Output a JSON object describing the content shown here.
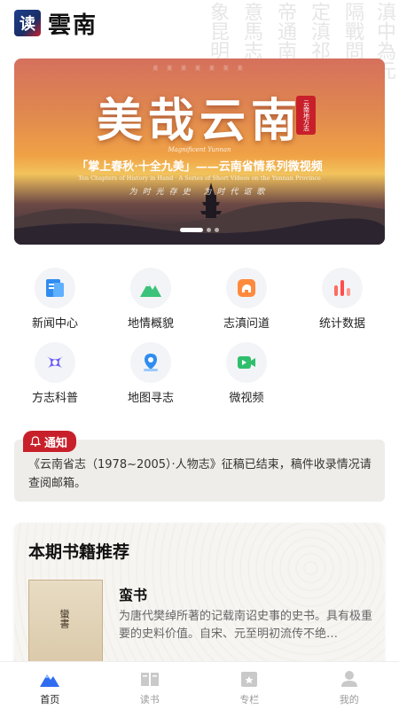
{
  "header": {
    "logo_char": "读",
    "app_name": "雲南"
  },
  "background_text": [
    "滇中為元",
    "隔戰問",
    "定滇祁",
    "帝通南",
    "意馬志",
    "象昆明"
  ],
  "banner": {
    "top_line": "美 美 美 美 美 美 美",
    "title": "美哉云南",
    "seal": "云南地方志",
    "en_title": "Magnificent Yunnan",
    "subtitle": "「掌上春秋·十全九美」——云南省情系列微视频",
    "en_subtitle": "Ten Chapters of History in Hand · A Series of Short Videos on the Yunnan Province",
    "slogan": "为时光存史  为时代讴歌",
    "slides": 3,
    "active_slide": 0
  },
  "features": [
    {
      "label": "新闻中心",
      "icon": "news-icon"
    },
    {
      "label": "地情概貌",
      "icon": "mountain-icon"
    },
    {
      "label": "志滇问道",
      "icon": "elephant-icon"
    },
    {
      "label": "统计数据",
      "icon": "bar-chart-icon"
    },
    {
      "label": "方志科普",
      "icon": "science-icon"
    },
    {
      "label": "地图寻志",
      "icon": "map-pin-icon"
    },
    {
      "label": "微视频",
      "icon": "video-icon"
    }
  ],
  "notice": {
    "tag": "通知",
    "text": "《云南省志（1978~2005）·人物志》征稿已结束，稿件收录情况请查阅邮箱。"
  },
  "books": {
    "section_title": "本期书籍推荐",
    "items": [
      {
        "name": "蛮书",
        "cover_title": "蠻書",
        "description": "为唐代樊绰所著的记载南诏史事的史书。具有极重要的史料价值。自宋、元至明初流传不绝…"
      }
    ]
  },
  "tabbar": [
    {
      "label": "首页",
      "icon": "home-icon",
      "active": true
    },
    {
      "label": "读书",
      "icon": "book-icon",
      "active": false
    },
    {
      "label": "专栏",
      "icon": "column-icon",
      "active": false
    },
    {
      "label": "我的",
      "icon": "user-icon",
      "active": false
    }
  ],
  "colors": {
    "accent_red": "#c8202a",
    "brand_blue": "#1d3f8c",
    "active_tab": "#222222",
    "inactive_tab": "#999999"
  }
}
